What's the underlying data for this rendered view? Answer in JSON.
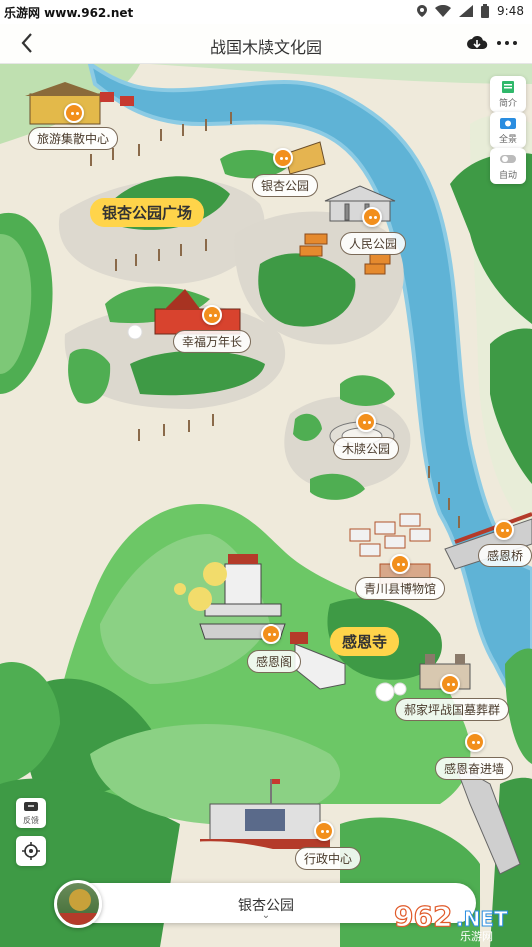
{
  "status_bar": {
    "watermark": "乐游网 www.962.net",
    "time": "9:48"
  },
  "header": {
    "title": "战国木牍文化园"
  },
  "side_controls": {
    "intro": "简介",
    "panorama": "全景",
    "auto": "自动"
  },
  "left_controls": {
    "feedback": "反馈"
  },
  "map": {
    "big_labels": {
      "ginkgo_plaza": "银杏公园广场",
      "ganen_temple": "感恩寺"
    },
    "pois": {
      "tourist_center": "旅游集散中心",
      "ginkgo_park": "银杏公园",
      "people_park": "人民公园",
      "happiness": "幸福万年长",
      "mudu_park": "木牍公园",
      "ganen_bridge": "感恩桥",
      "museum": "青川县博物馆",
      "ganen_pavilion": "感恩阁",
      "tombs": "郝家坪战国墓葬群",
      "ganen_wall": "感恩奋进墙",
      "admin_center": "行政中心"
    }
  },
  "bottom_bar": {
    "current": "银杏公园"
  },
  "brand_watermark": {
    "number": "962",
    "suffix": ".NET",
    "sub": "乐游网"
  },
  "colors": {
    "river": "#5fb3d6",
    "river_edge": "#8ccbe4",
    "grass_dark": "#3e9a45",
    "grass_light": "#8bd184",
    "mountain": "#6cc766",
    "pin": "#f28f1c",
    "label_yellow": "#ffd44a",
    "parchment": "#efeadb"
  }
}
